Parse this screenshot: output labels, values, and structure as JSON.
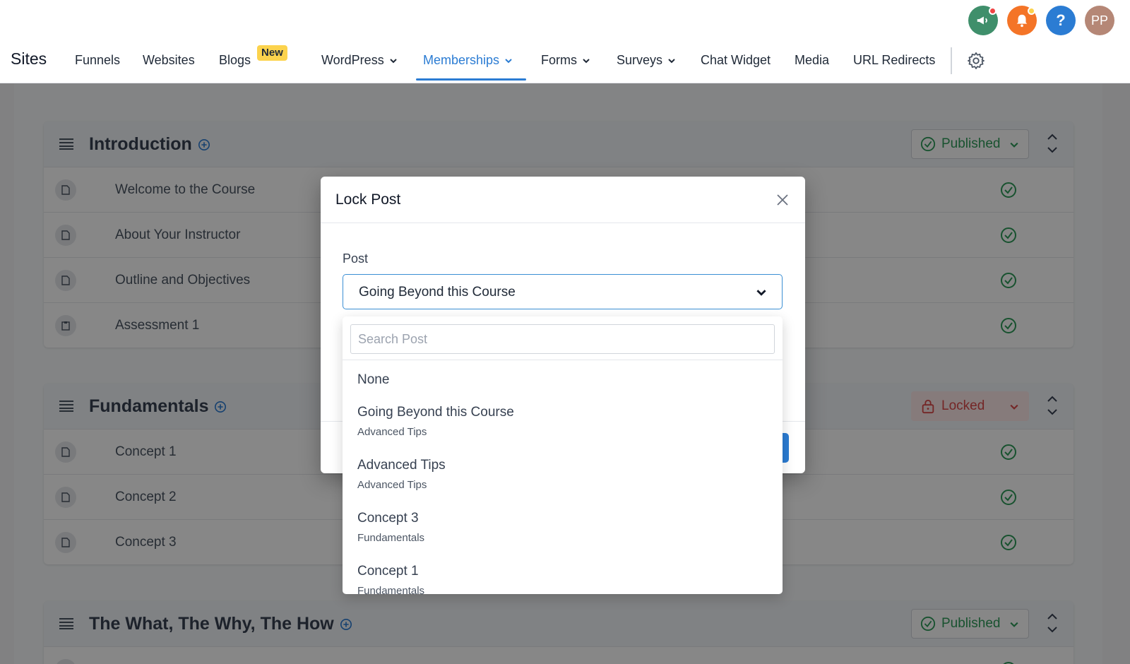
{
  "app": {
    "brand": "Sites"
  },
  "nav": {
    "items": [
      {
        "label": "Funnels"
      },
      {
        "label": "Websites"
      },
      {
        "label": "Blogs",
        "badge": "New"
      },
      {
        "label": "WordPress"
      },
      {
        "label": "Memberships"
      },
      {
        "label": "Forms"
      },
      {
        "label": "Surveys"
      },
      {
        "label": "Chat Widget"
      },
      {
        "label": "Media"
      },
      {
        "label": "URL Redirects"
      }
    ],
    "active": "Memberships"
  },
  "header": {
    "avatar_initials": "PP",
    "help_label": "?"
  },
  "colors": {
    "accent": "#2b7cd3",
    "published": "#2e9b5a",
    "locked": "#dc4949",
    "badge": "#fcd34d"
  },
  "sections": [
    {
      "title": "Introduction",
      "status": "Published",
      "rows": [
        "Welcome to the Course",
        "About Your Instructor",
        "Outline and Objectives",
        "Assessment 1"
      ]
    },
    {
      "title": "Fundamentals",
      "status": "Locked",
      "rows": [
        "Concept 1",
        "Concept 2",
        "Concept 3"
      ]
    },
    {
      "title": "The What, The Why, The How",
      "status": "Published",
      "rows": []
    }
  ],
  "modal": {
    "title": "Lock Post",
    "field_label": "Post",
    "selected": "Going Beyond this Course",
    "search_placeholder": "Search Post",
    "options": [
      {
        "title": "None",
        "sub": ""
      },
      {
        "title": "Going Beyond this Course",
        "sub": "Advanced Tips"
      },
      {
        "title": "Advanced Tips",
        "sub": "Advanced Tips"
      },
      {
        "title": "Concept 3",
        "sub": "Fundamentals"
      },
      {
        "title": "Concept 1",
        "sub": "Fundamentals"
      }
    ]
  }
}
